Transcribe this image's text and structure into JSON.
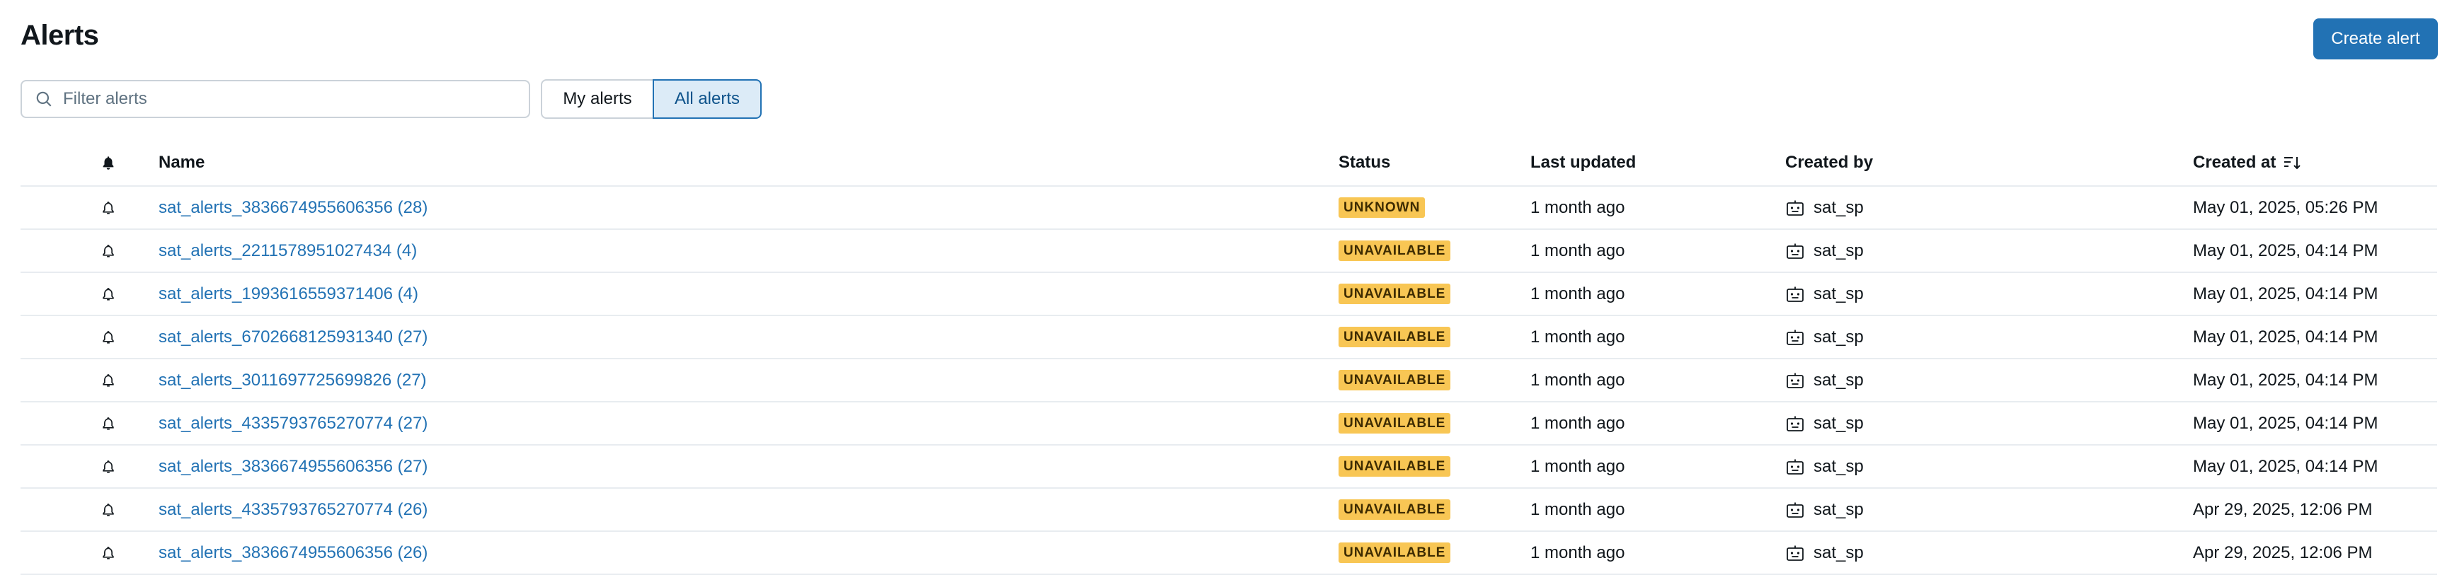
{
  "header": {
    "title": "Alerts",
    "create_label": "Create alert"
  },
  "filter": {
    "placeholder": "Filter alerts",
    "value": ""
  },
  "toggle": {
    "my_alerts": "My alerts",
    "all_alerts": "All alerts",
    "selected": "All alerts"
  },
  "columns": {
    "notify_icon": "bell-icon",
    "name": "Name",
    "status": "Status",
    "last_updated": "Last updated",
    "created_by": "Created by",
    "created_at": "Created at",
    "sort_icon": "sort-descending-icon"
  },
  "rows": [
    {
      "name": "sat_alerts_3836674955606356 (28)",
      "status": "UNKNOWN",
      "last_updated": "1 month ago",
      "created_by": "sat_sp",
      "created_at": "May 01, 2025, 05:26 PM"
    },
    {
      "name": "sat_alerts_2211578951027434 (4)",
      "status": "UNAVAILABLE",
      "last_updated": "1 month ago",
      "created_by": "sat_sp",
      "created_at": "May 01, 2025, 04:14 PM"
    },
    {
      "name": "sat_alerts_1993616559371406 (4)",
      "status": "UNAVAILABLE",
      "last_updated": "1 month ago",
      "created_by": "sat_sp",
      "created_at": "May 01, 2025, 04:14 PM"
    },
    {
      "name": "sat_alerts_6702668125931340 (27)",
      "status": "UNAVAILABLE",
      "last_updated": "1 month ago",
      "created_by": "sat_sp",
      "created_at": "May 01, 2025, 04:14 PM"
    },
    {
      "name": "sat_alerts_3011697725699826 (27)",
      "status": "UNAVAILABLE",
      "last_updated": "1 month ago",
      "created_by": "sat_sp",
      "created_at": "May 01, 2025, 04:14 PM"
    },
    {
      "name": "sat_alerts_4335793765270774 (27)",
      "status": "UNAVAILABLE",
      "last_updated": "1 month ago",
      "created_by": "sat_sp",
      "created_at": "May 01, 2025, 04:14 PM"
    },
    {
      "name": "sat_alerts_3836674955606356 (27)",
      "status": "UNAVAILABLE",
      "last_updated": "1 month ago",
      "created_by": "sat_sp",
      "created_at": "May 01, 2025, 04:14 PM"
    },
    {
      "name": "sat_alerts_4335793765270774 (26)",
      "status": "UNAVAILABLE",
      "last_updated": "1 month ago",
      "created_by": "sat_sp",
      "created_at": "Apr 29, 2025, 12:06 PM"
    },
    {
      "name": "sat_alerts_3836674955606356 (26)",
      "status": "UNAVAILABLE",
      "last_updated": "1 month ago",
      "created_by": "sat_sp",
      "created_at": "Apr 29, 2025, 12:06 PM"
    }
  ],
  "colors": {
    "accent": "#2272b4",
    "status_badge": "#f8c654"
  }
}
